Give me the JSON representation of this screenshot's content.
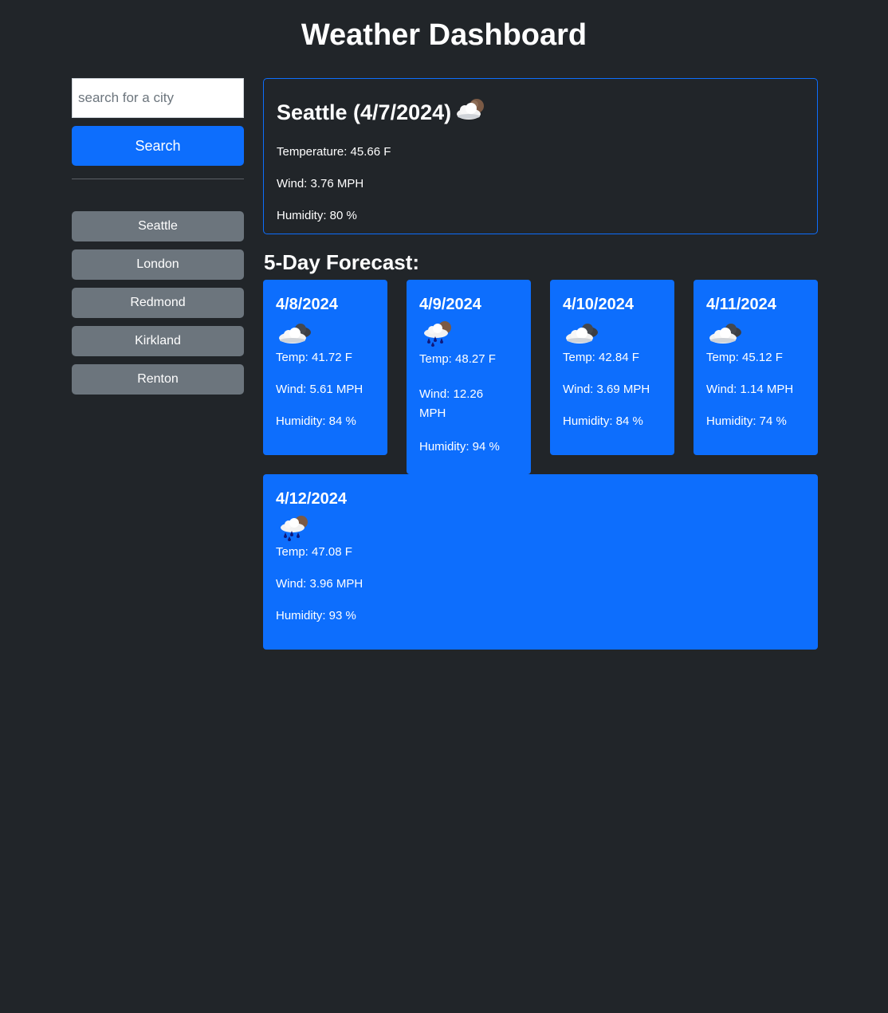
{
  "header": {
    "title": "Weather Dashboard"
  },
  "sidebar": {
    "search_placeholder": "search for a city",
    "search_value": "",
    "search_button_label": "Search",
    "history": [
      "Seattle",
      "London",
      "Redmond",
      "Kirkland",
      "Renton"
    ]
  },
  "current": {
    "heading": "Seattle (4/7/2024)",
    "icon": "partly-cloudy-icon",
    "temperature": "Temperature: 45.66 F",
    "wind": "Wind: 3.76 MPH",
    "humidity": "Humidity: 80 %"
  },
  "forecast": {
    "heading": "5-Day Forecast:",
    "days": [
      {
        "date": "4/8/2024",
        "icon": "overcast-clouds-icon",
        "temp": "Temp: 41.72 F",
        "wind": "Wind: 5.61 MPH",
        "humidity": "Humidity: 84 %"
      },
      {
        "date": "4/9/2024",
        "icon": "rain-icon",
        "temp": "Temp: 48.27 F",
        "wind": "Wind: 12.26 MPH",
        "humidity": "Humidity: 94 %"
      },
      {
        "date": "4/10/2024",
        "icon": "overcast-clouds-icon",
        "temp": "Temp: 42.84 F",
        "wind": "Wind: 3.69 MPH",
        "humidity": "Humidity: 84 %"
      },
      {
        "date": "4/11/2024",
        "icon": "overcast-clouds-icon",
        "temp": "Temp: 45.12 F",
        "wind": "Wind: 1.14 MPH",
        "humidity": "Humidity: 74 %"
      },
      {
        "date": "4/12/2024",
        "icon": "rain-icon",
        "temp": "Temp: 47.08 F",
        "wind": "Wind: 3.96 MPH",
        "humidity": "Humidity: 93 %"
      }
    ]
  },
  "colors": {
    "background": "#212529",
    "primary": "#0d6efd",
    "secondary": "#6c757d",
    "text": "#ffffff"
  }
}
